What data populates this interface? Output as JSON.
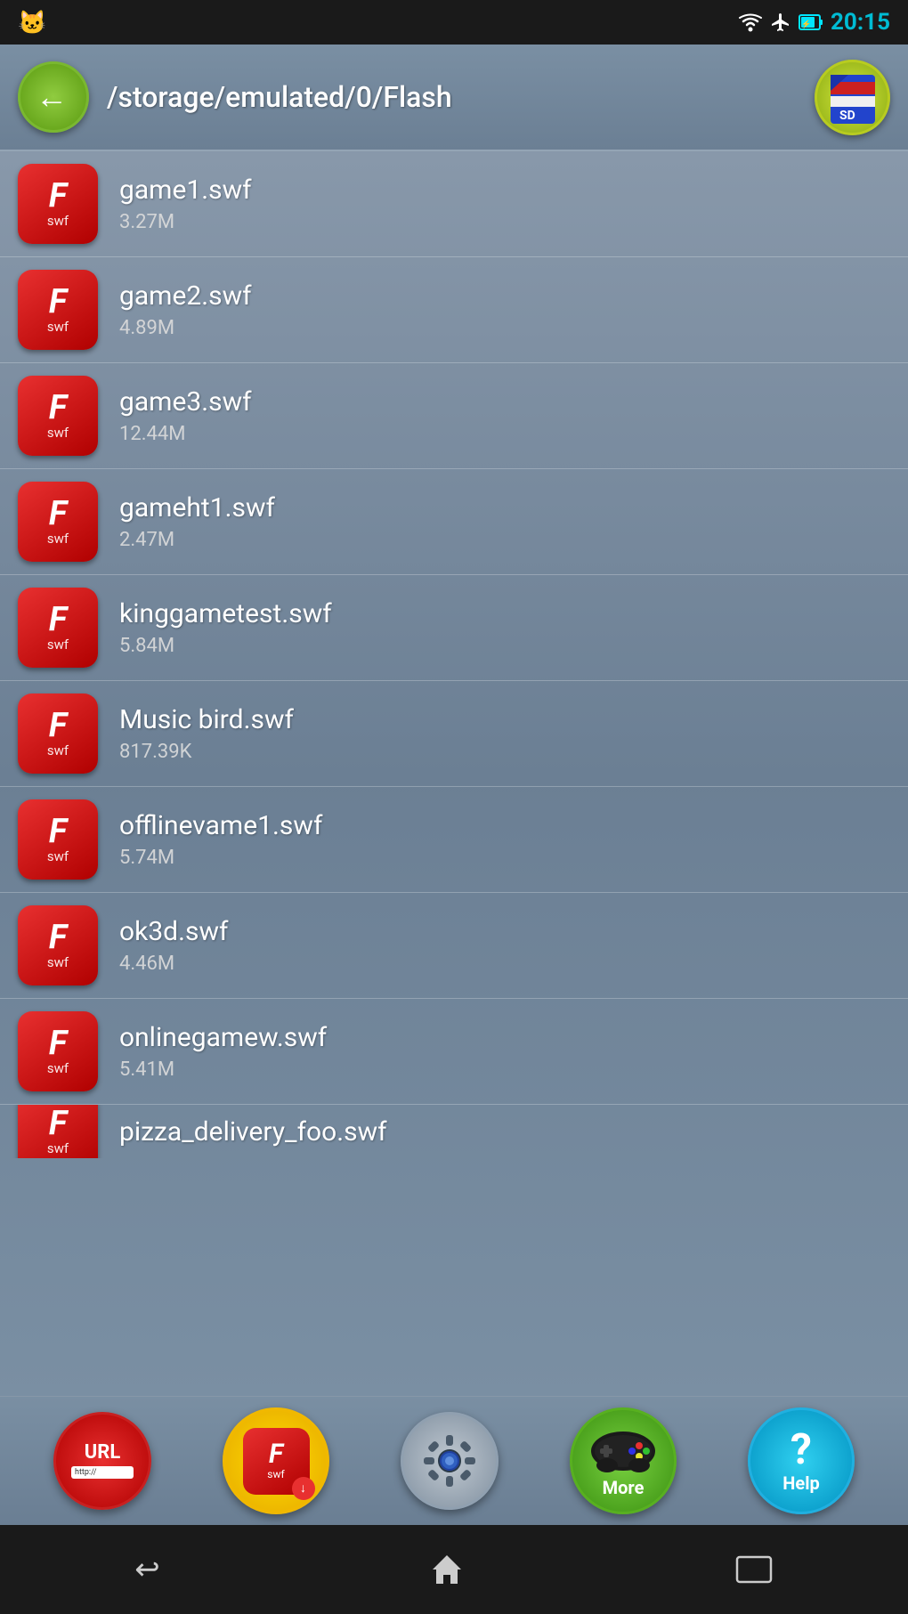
{
  "statusBar": {
    "time": "20:15",
    "catIcon": "🐱"
  },
  "header": {
    "backLabel": "←",
    "path": "/storage/emulated/0/Flash"
  },
  "files": [
    {
      "name": "game1.swf",
      "size": "3.27M"
    },
    {
      "name": "game2.swf",
      "size": "4.89M"
    },
    {
      "name": "game3.swf",
      "size": "12.44M"
    },
    {
      "name": "gameht1.swf",
      "size": "2.47M"
    },
    {
      "name": "kinggametest.swf",
      "size": "5.84M"
    },
    {
      "name": "Music bird.swf",
      "size": "817.39K"
    },
    {
      "name": "offlinevame1.swf",
      "size": "5.74M"
    },
    {
      "name": "ok3d.swf",
      "size": "4.46M"
    },
    {
      "name": "onlinegamew.swf",
      "size": "5.41M"
    },
    {
      "name": "pizza_delivery_foo.swf",
      "size": ""
    }
  ],
  "toolbar": {
    "urlLabel": "URL",
    "urlBarText": "http://",
    "downloadLabel": "F swf",
    "moreLabel": "More",
    "helpLabel": "Help"
  },
  "navBar": {
    "backIcon": "↩",
    "homeIcon": "⌂",
    "recentIcon": "▭"
  }
}
